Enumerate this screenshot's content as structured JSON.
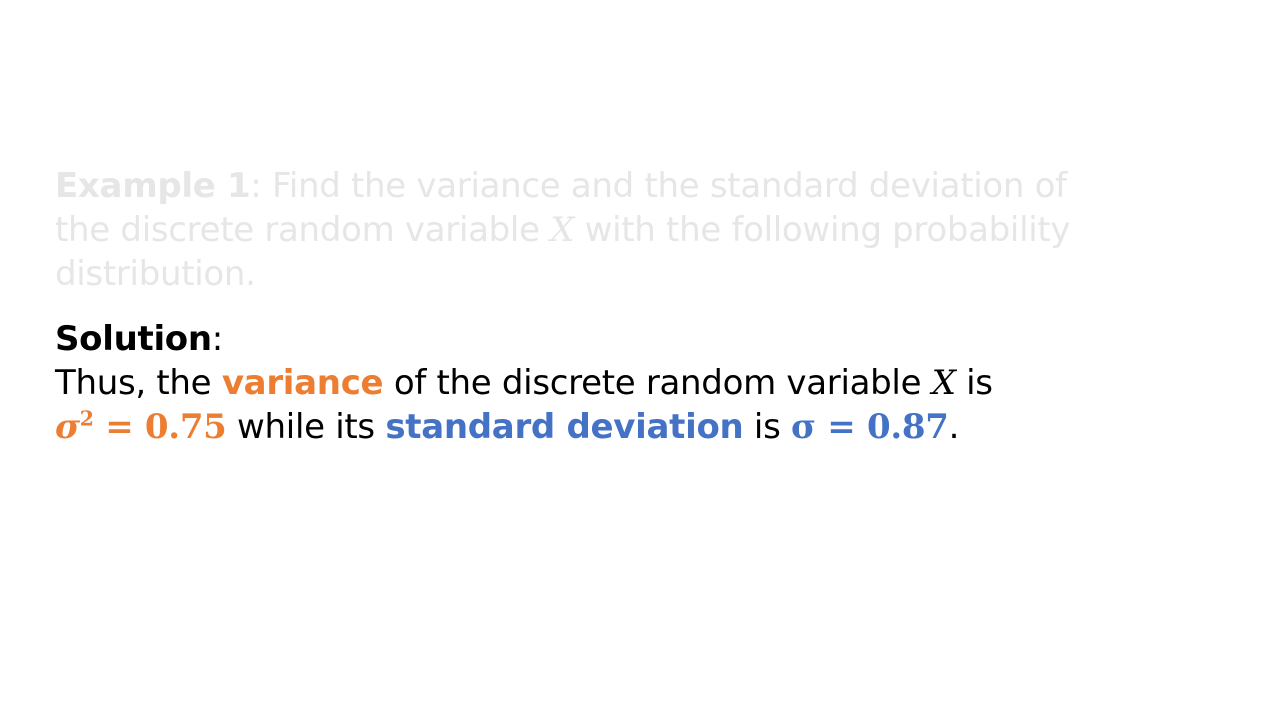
{
  "example": {
    "label": "Example 1",
    "line1": ": Find the variance and the standard deviation of",
    "line2a": "the discrete random variable ",
    "var": "X",
    "line2b": " with the following probability",
    "line3": "distribution."
  },
  "solution": {
    "label": "Solution",
    "colon": ":",
    "line1a": "Thus, the ",
    "variance_word": "variance",
    "line1b": " of the discrete random variable ",
    "var": "X",
    "line1c": " is",
    "variance_sym": "σ",
    "variance_exp": "2",
    "variance_val": " = 0.75",
    "line2a": " while its ",
    "sd_word": "standard deviation",
    "line2b": " is ",
    "sd_expr": "σ = 0.87",
    "period": "."
  },
  "colors": {
    "orange": "#ed7d31",
    "blue": "#4472c4",
    "faded": "#e6e6e6"
  }
}
